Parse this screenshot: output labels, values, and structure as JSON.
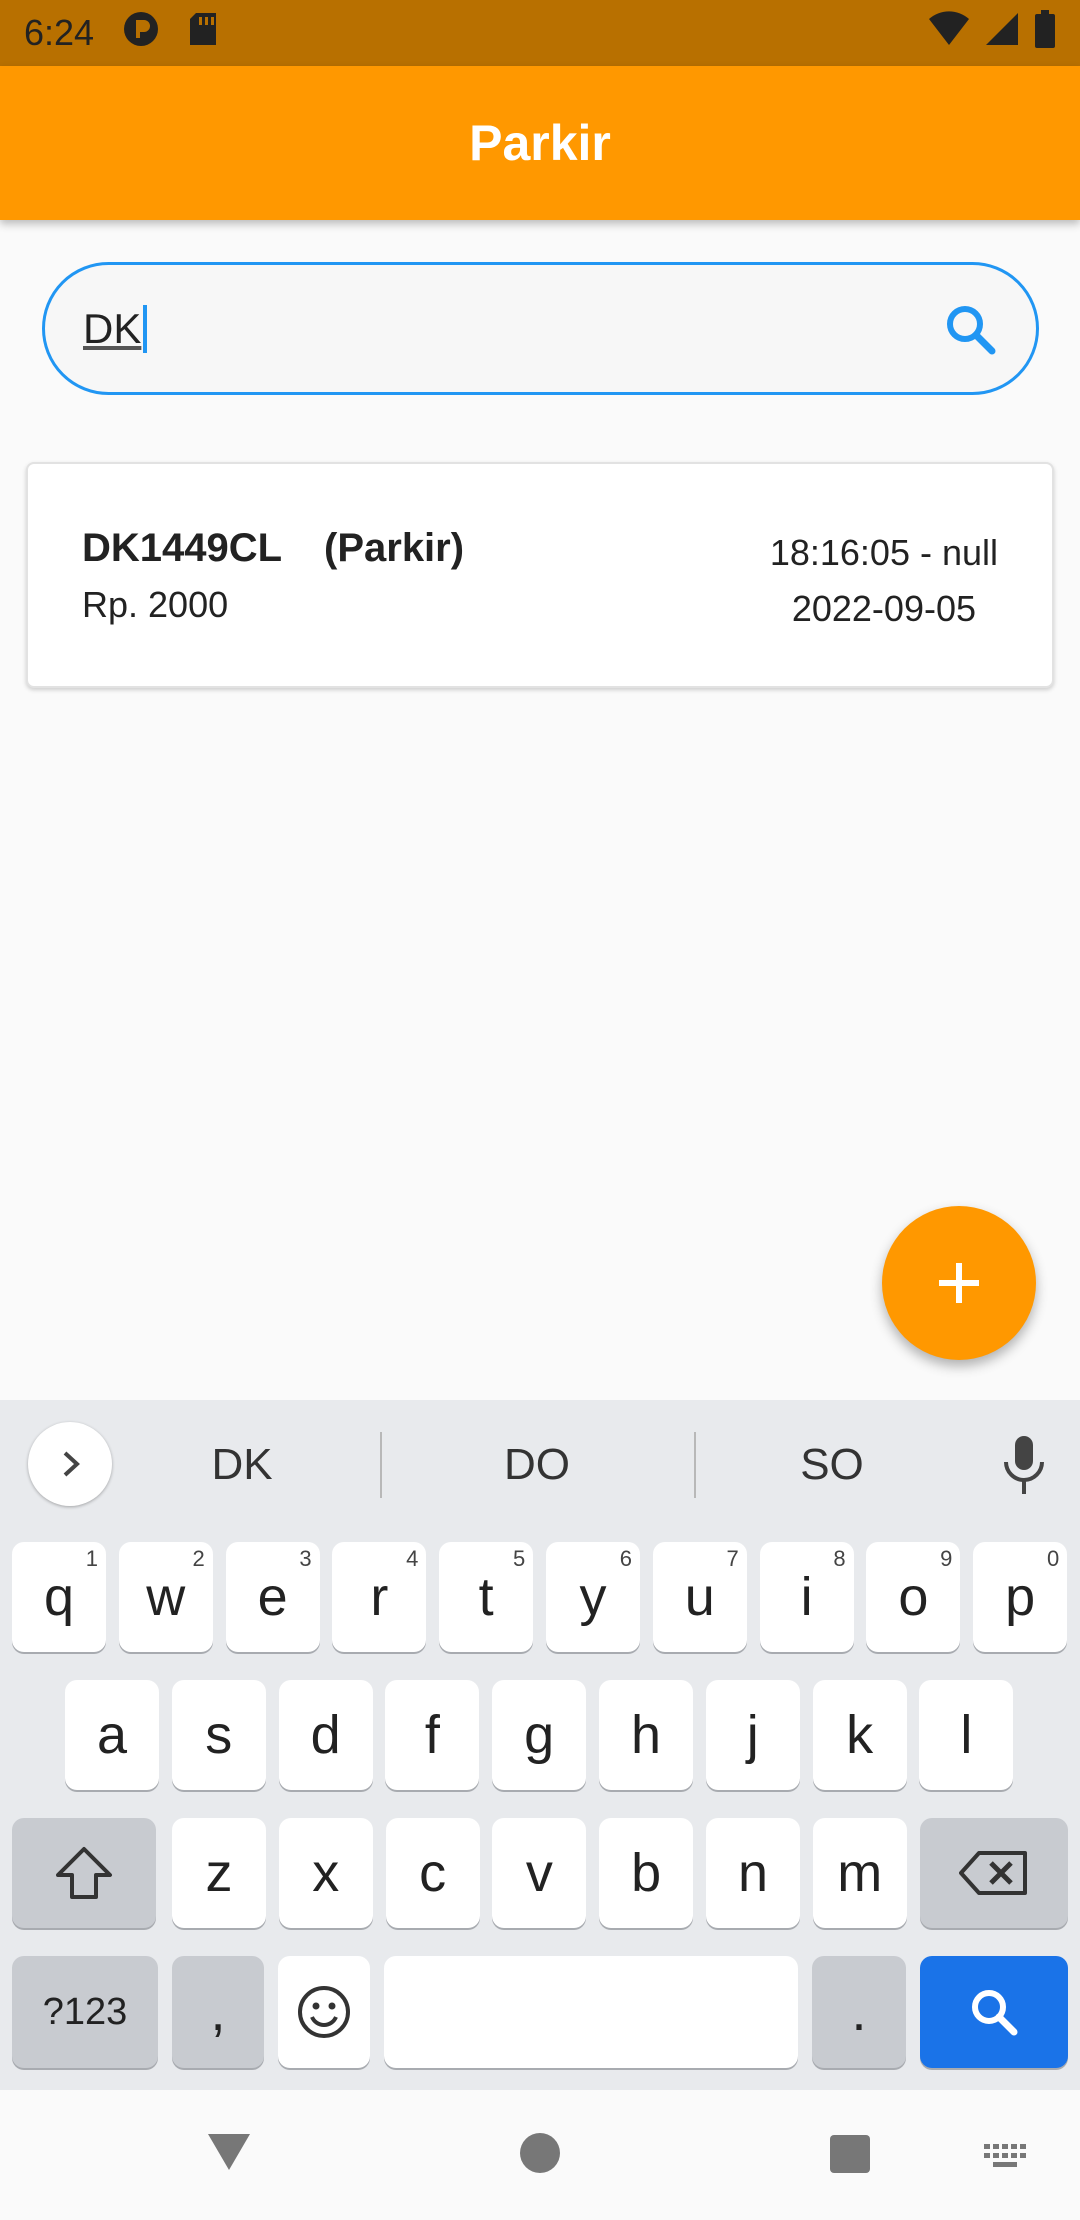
{
  "status_bar": {
    "time": "6:24"
  },
  "app_bar": {
    "title": "Parkir"
  },
  "search": {
    "value": "DK"
  },
  "results": [
    {
      "plate": "DK1449CL",
      "status": "(Parkir)",
      "price": "Rp. 2000",
      "time": "18:16:05 - null",
      "date": "2022-09-05"
    }
  ],
  "keyboard": {
    "suggestions": [
      "DK",
      "DO",
      "SO"
    ],
    "row1": [
      {
        "k": "q",
        "n": "1"
      },
      {
        "k": "w",
        "n": "2"
      },
      {
        "k": "e",
        "n": "3"
      },
      {
        "k": "r",
        "n": "4"
      },
      {
        "k": "t",
        "n": "5"
      },
      {
        "k": "y",
        "n": "6"
      },
      {
        "k": "u",
        "n": "7"
      },
      {
        "k": "i",
        "n": "8"
      },
      {
        "k": "o",
        "n": "9"
      },
      {
        "k": "p",
        "n": "0"
      }
    ],
    "row2": [
      "a",
      "s",
      "d",
      "f",
      "g",
      "h",
      "j",
      "k",
      "l"
    ],
    "row3": [
      "z",
      "x",
      "c",
      "v",
      "b",
      "n",
      "m"
    ],
    "symbols_label": "?123",
    "comma": ",",
    "period": "."
  },
  "colors": {
    "accent": "#ff9800",
    "status_bar": "#b87000",
    "focus": "#2196f3",
    "keyboard_action": "#1a73e8"
  },
  "icons": [
    "wifi-icon",
    "signal-icon",
    "battery-icon",
    "search-icon",
    "add-icon",
    "mic-icon",
    "backspace-icon",
    "shift-icon",
    "emoji-icon"
  ]
}
